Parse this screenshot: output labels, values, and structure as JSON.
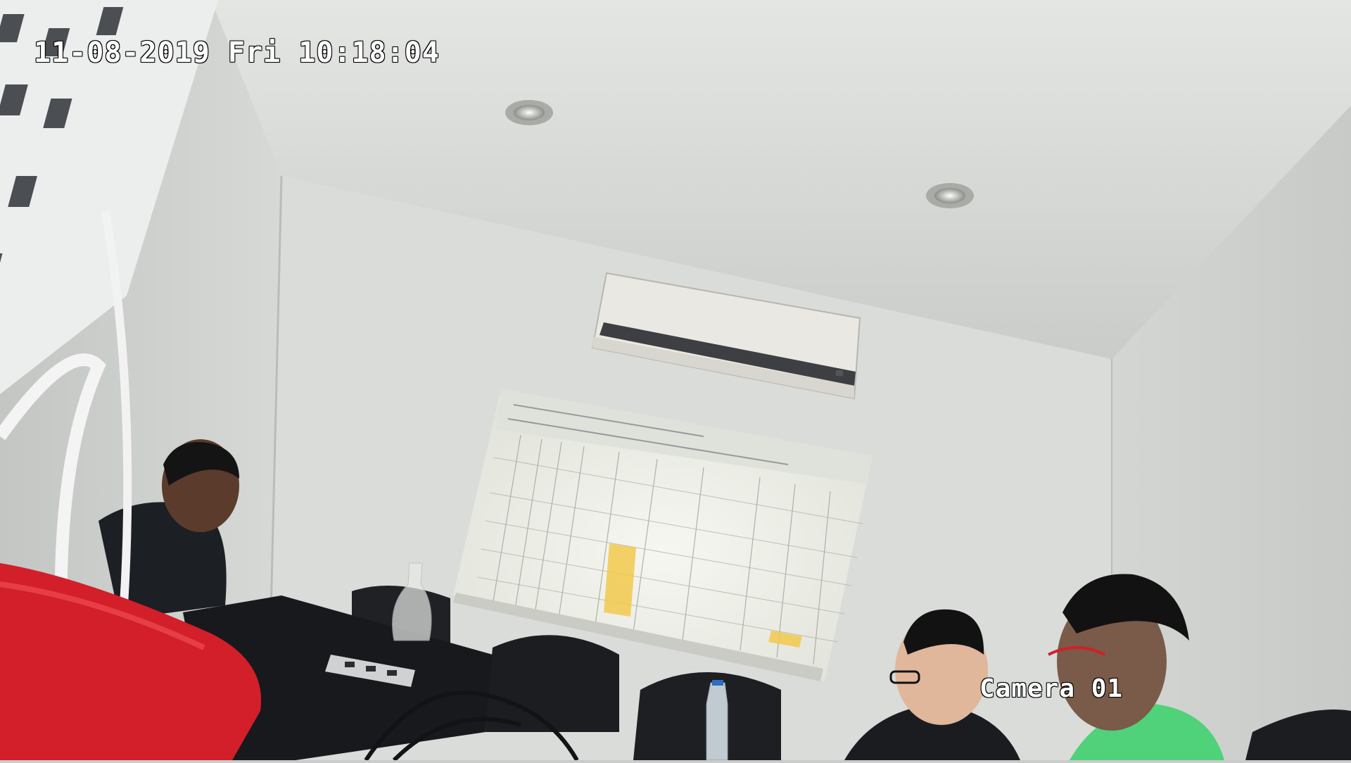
{
  "osd": {
    "timestamp": "11-08-2019 Fri 10:18:04",
    "camera_label": "Camera 01"
  },
  "colors": {
    "wall": "#d8dbd8",
    "ceiling": "#cfd2cf",
    "projection": "#eef0e8",
    "highlight_cells": "#f2c94c",
    "red_device": "#d21f2a",
    "shirt_green": "#4fd27a",
    "dark_clothing": "#1c1f24"
  },
  "scene": {
    "description_icons": [
      "air-conditioner-icon",
      "ceiling-light-icon",
      "projector-icon",
      "water-bottle-icon",
      "office-chair-icon"
    ]
  }
}
